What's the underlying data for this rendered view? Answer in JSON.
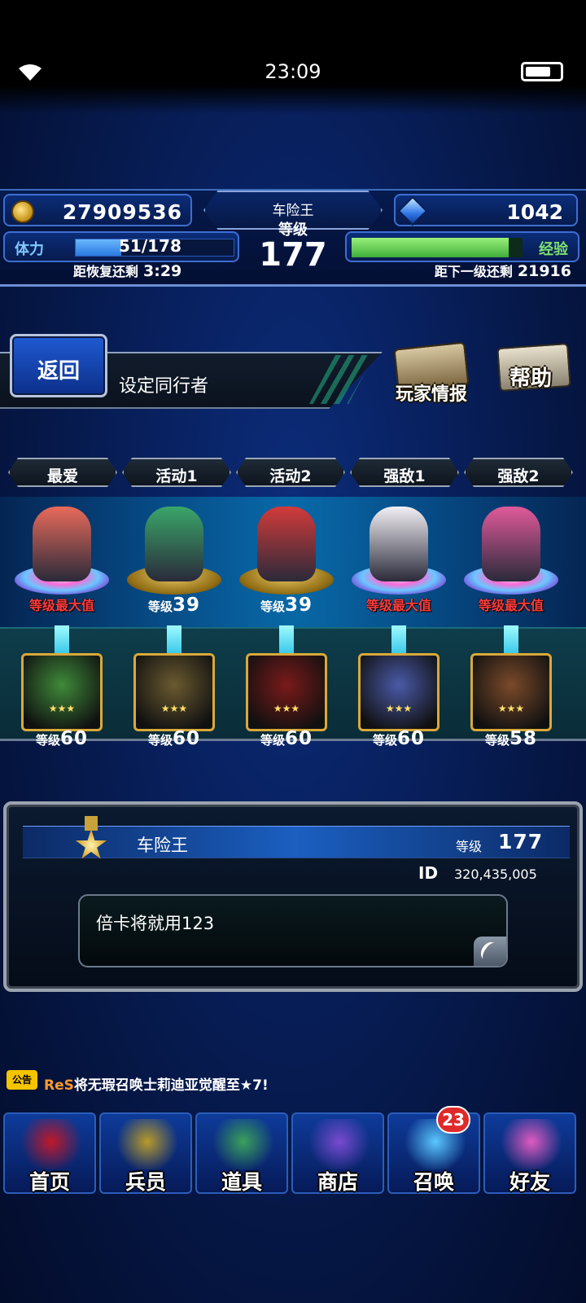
{
  "status_bar": {
    "time": "23:09"
  },
  "hud": {
    "gil": "27909536",
    "gems": "1042",
    "player_name": "车险王",
    "level_label": "等级",
    "level": "177",
    "stamina_label": "体力",
    "stamina_value": "51/178",
    "stamina_fraction": 0.287,
    "exp_label": "经验",
    "exp_fraction": 0.92,
    "recover_label": "距恢复还剩",
    "recover_time": "3:29",
    "next_label": "距下一级还剩",
    "next_exp": "21916"
  },
  "header": {
    "back_label": "返回",
    "title": "设定同行者",
    "player_info_label": "玩家情报",
    "help_label": "帮助"
  },
  "tabs": [
    {
      "label": "最爱"
    },
    {
      "label": "活动1"
    },
    {
      "label": "活动2"
    },
    {
      "label": "强敌1"
    },
    {
      "label": "强敌2"
    }
  ],
  "units": [
    {
      "level_text": "等级最大值",
      "is_max": true,
      "pedestal": "rainbow",
      "sprite_color": "#e86a5a"
    },
    {
      "level_label": "等级",
      "level": "39",
      "is_max": false,
      "pedestal": "gold",
      "sprite_color": "#3aa66a"
    },
    {
      "level_label": "等级",
      "level": "39",
      "is_max": false,
      "pedestal": "gold",
      "sprite_color": "#d23a3a"
    },
    {
      "level_text": "等级最大值",
      "is_max": true,
      "pedestal": "rainbow",
      "sprite_color": "#f2f0f4"
    },
    {
      "level_text": "等级最大值",
      "is_max": true,
      "pedestal": "rainbow",
      "sprite_color": "#e05a9a"
    }
  ],
  "espers": [
    {
      "stars": "★★★",
      "level_label": "等级",
      "level": "60",
      "color": "#3f8a3a"
    },
    {
      "stars": "★★★",
      "level_label": "等级",
      "level": "60",
      "color": "#6a5a30"
    },
    {
      "stars": "★★★",
      "level_label": "等级",
      "level": "60",
      "color": "#7a1a1a"
    },
    {
      "stars": "★★★",
      "level_label": "等级",
      "level": "60",
      "color": "#4a5aa8"
    },
    {
      "stars": "★★★",
      "level_label": "等级",
      "level": "58",
      "color": "#7a4a2a"
    }
  ],
  "profile": {
    "name": "车险王",
    "level_label": "等级",
    "level": "177",
    "id_label": "ID",
    "id": "320,435,005",
    "message": "倍卡将就用123"
  },
  "ticker": {
    "badge": "公告",
    "prefix": "ReS",
    "text": "将无瑕召唤士莉迪亚觉醒至★7!"
  },
  "nav": [
    {
      "label": "首页",
      "icon": "sword-icon",
      "art_color": "#c0182a"
    },
    {
      "label": "兵员",
      "icon": "warrior-icon",
      "art_color": "#b89a2a"
    },
    {
      "label": "道具",
      "icon": "potion-icon",
      "art_color": "#3aa05a"
    },
    {
      "label": "商店",
      "icon": "shop-icon",
      "art_color": "#7a4ad0"
    },
    {
      "label": "召唤",
      "icon": "crystal-icon",
      "art_color": "#5ac7ff",
      "badge": "23"
    },
    {
      "label": "好友",
      "icon": "friends-icon",
      "art_color": "#e05ac0"
    }
  ]
}
